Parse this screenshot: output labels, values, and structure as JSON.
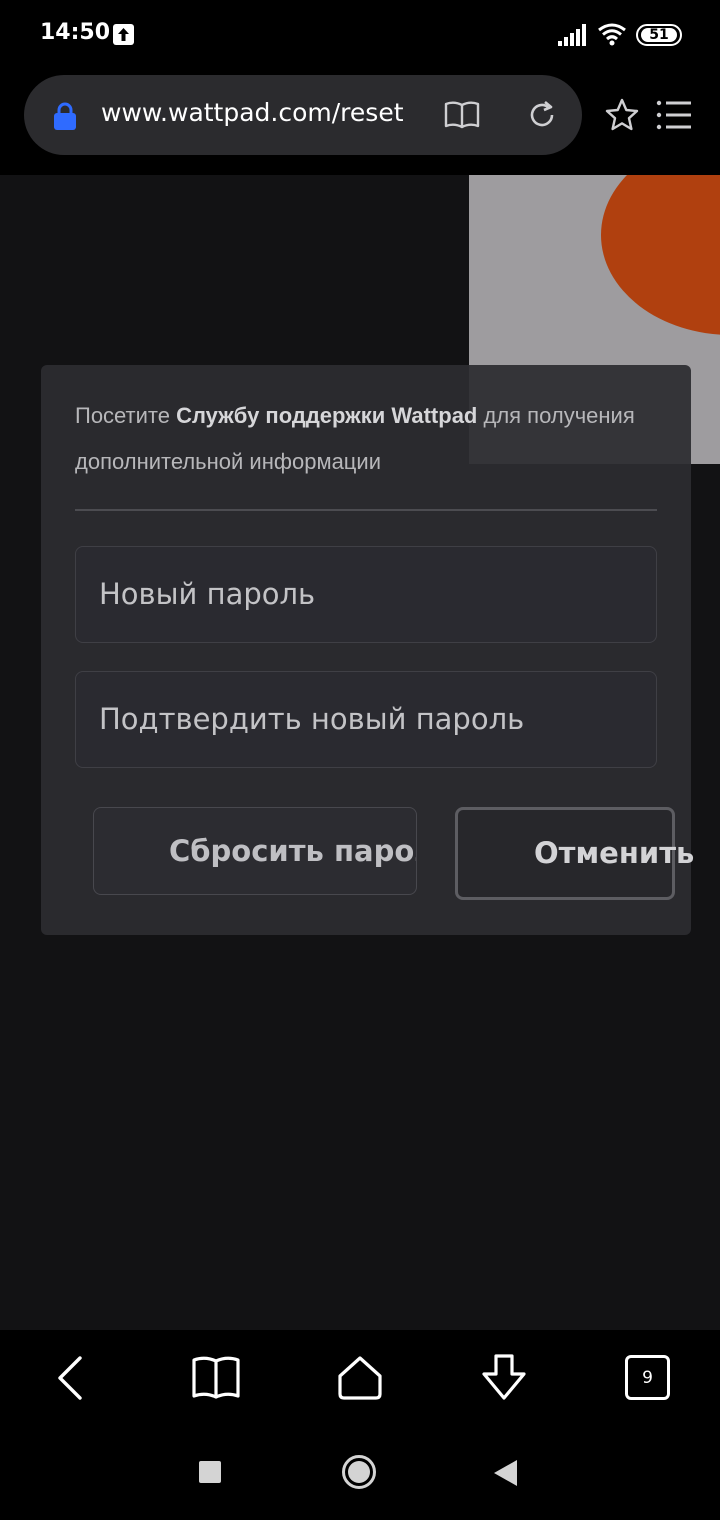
{
  "status_bar": {
    "time": "14:50",
    "battery": "51",
    "icons": [
      "upload-icon",
      "signal-icon",
      "wifi-icon",
      "battery-icon"
    ]
  },
  "browser": {
    "url": "www.wattpad.com/reset",
    "icons": [
      "lock-icon",
      "reader-mode-icon",
      "reload-icon",
      "star-icon",
      "menu-icon"
    ],
    "lock_color": "#2f6bff"
  },
  "card": {
    "help_prefix": "Посетите ",
    "help_link": "Службу поддержки Wattpad",
    "help_suffix": " для получения дополнительной информации",
    "new_password_placeholder": "Новый пароль",
    "confirm_password_placeholder": "Подтвердить новый пароль",
    "reset_button": "Сбросить пароль",
    "cancel_button": "Отменить"
  },
  "bottom_nav": {
    "tab_count": "9",
    "icons": [
      "back-icon",
      "bookmarks-icon",
      "home-icon",
      "download-icon",
      "tabs-icon"
    ]
  },
  "system_nav": {
    "icons": [
      "recents-icon",
      "home-circle-icon",
      "back-triangle-icon"
    ]
  },
  "colors": {
    "page_background": "#121214",
    "deco_orange": "#b0400f",
    "deco_gray": "#9e9c9f"
  }
}
